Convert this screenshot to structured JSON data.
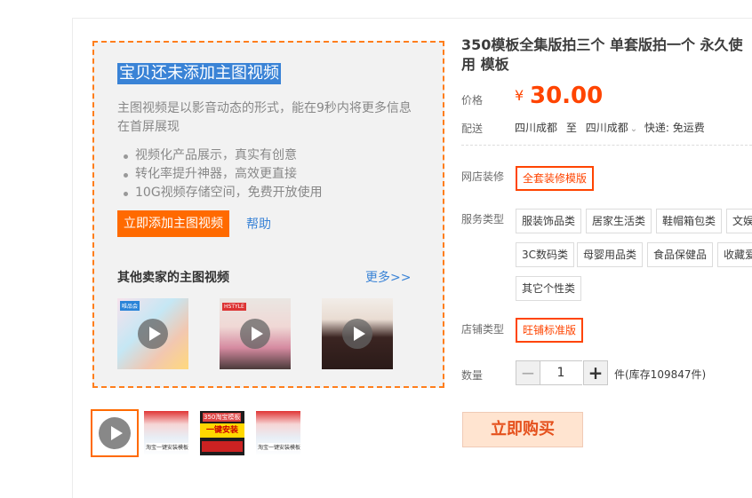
{
  "promo": {
    "title": "宝贝还未添加主图视频",
    "description": "主图视频是以影音动态的形式，能在9秒内将更多信息在首屏展现",
    "bullets": [
      "视频化产品展示，真实有创意",
      "转化率提升神器，高效更直接",
      "10G视频存储空间，免费开放使用"
    ],
    "add_button": "立即添加主图视频",
    "help_link": "帮助",
    "others_title": "其他卖家的主图视频",
    "more_link": "更多>>",
    "video_thumbs": [
      {
        "tag": "唯品会"
      },
      {
        "tag": "HSTYLE"
      },
      {
        "tag": ""
      }
    ]
  },
  "gallery": {
    "thumb3_top": "350淘宝模板",
    "thumb3_band": "一键安装",
    "thumb2_caption": "淘宝一键安装模板",
    "thumb4_caption": "淘宝一键安装模板"
  },
  "product": {
    "title": "350模板全集版拍三个 单套版拍一个 永久使用 模板",
    "price_label": "价格",
    "price_symbol": "¥",
    "price": "30.00",
    "shipping_label": "配送",
    "ship_from": "四川成都",
    "ship_to_word": "至",
    "ship_to": "四川成都",
    "ship_chevron": "⌄",
    "ship_method": "快递: 免运费",
    "decor_label": "网店装修",
    "decor_option": "全套装修模版",
    "service_label": "服务类型",
    "service_options": [
      "服装饰品类",
      "居家生活类",
      "鞋帽箱包类",
      "文娱",
      "3C数码类",
      "母婴用品类",
      "食品保健品",
      "收藏爱",
      "其它个性类"
    ],
    "shop_label": "店铺类型",
    "shop_option": "旺铺标准版",
    "qty_label": "数量",
    "qty_minus": "−",
    "qty_value": "1",
    "qty_plus": "+",
    "stock": "件(库存109847件)",
    "buy_button": "立即购买"
  }
}
